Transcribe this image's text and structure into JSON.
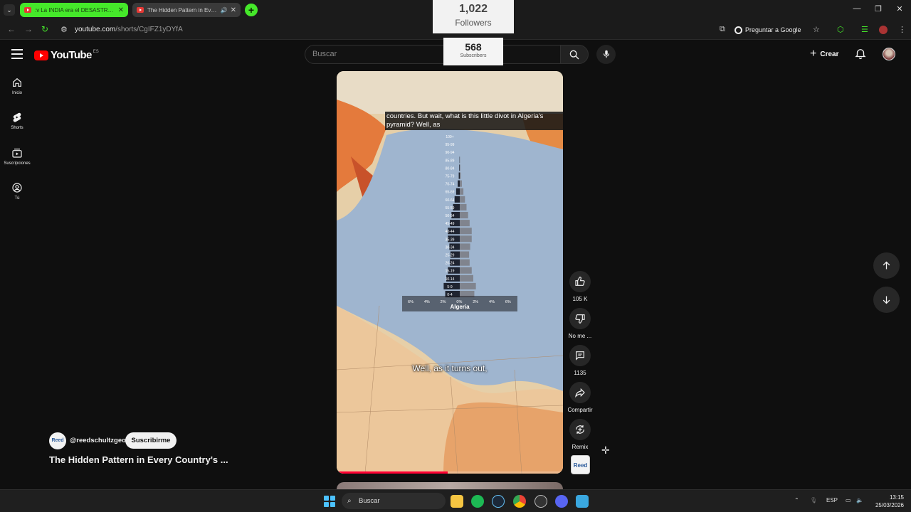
{
  "browser": {
    "tabs": [
      {
        "title": "La INDIA era el DESASTRE q",
        "prefix": ":v",
        "active": false
      },
      {
        "title": "The Hidden Pattern in Every",
        "active": true
      }
    ],
    "url_domain": "youtube.com",
    "url_path": "/shorts/CgIFZ1yDYfA",
    "google_button": "Preguntar a Google"
  },
  "overlays": {
    "followers_count": "1,022",
    "followers_label": "Followers",
    "subscribers_count": "568",
    "subscribers_label": "Subscribers"
  },
  "youtube": {
    "logo_text": "YouTube",
    "country_code": "ES",
    "search_placeholder": "Buscar",
    "create_label": "Crear"
  },
  "sidebar": {
    "items": [
      {
        "label": "Inicio",
        "icon": "home-icon"
      },
      {
        "label": "Shorts",
        "icon": "shorts-icon"
      },
      {
        "label": "Suscripciones",
        "icon": "subscriptions-icon"
      },
      {
        "label": "Tú",
        "icon": "you-icon"
      }
    ]
  },
  "video": {
    "caption_text": "countries. But wait, what is this little divot in Algeria's pyramid? Well, as",
    "subtitle_text": "Well, as it turns out,",
    "pyramid_title": "Algeria",
    "age_groups": [
      "100+",
      "95-99",
      "90-94",
      "85-89",
      "80-84",
      "75-79",
      "70-74",
      "65-69",
      "60-64",
      "55-59",
      "50-54",
      "45-49",
      "40-44",
      "35-39",
      "30-34",
      "25-29",
      "20-24",
      "15-19",
      "10-14",
      "5-9",
      "0-4"
    ],
    "male_pct": [
      0.0,
      0.0,
      0.0,
      0.05,
      0.1,
      0.2,
      0.4,
      0.7,
      1.0,
      1.3,
      1.6,
      1.9,
      2.3,
      2.3,
      2.0,
      1.8,
      1.9,
      2.3,
      2.6,
      3.1,
      2.8
    ],
    "female_pct": [
      0.0,
      0.0,
      0.0,
      0.05,
      0.1,
      0.2,
      0.4,
      0.7,
      1.0,
      1.3,
      1.6,
      1.9,
      2.3,
      2.3,
      2.0,
      1.8,
      1.9,
      2.3,
      2.6,
      3.1,
      2.8
    ],
    "axis_ticks": [
      "6%",
      "4%",
      "2%",
      "0%",
      "2%",
      "4%",
      "6%"
    ],
    "progress": 0.49
  },
  "actions": {
    "like_count": "105 K",
    "dislike_label": "No me ...",
    "comments_count": "1135",
    "share_label": "Compartir",
    "remix_label": "Remix",
    "channel_thumb_text": "Reed"
  },
  "channel": {
    "avatar_text": "Reed",
    "handle": "@reedschultzgeo",
    "subscribe_label": "Suscribirme",
    "video_title": "The Hidden Pattern in Every Country's ..."
  },
  "taskbar": {
    "search_placeholder": "Buscar",
    "language": "ESP",
    "time": "13:15",
    "date": "25/03/2026"
  },
  "colors": {
    "accent_green": "#45e82a",
    "youtube_red": "#ff0000",
    "progress_red": "#ff0033"
  }
}
